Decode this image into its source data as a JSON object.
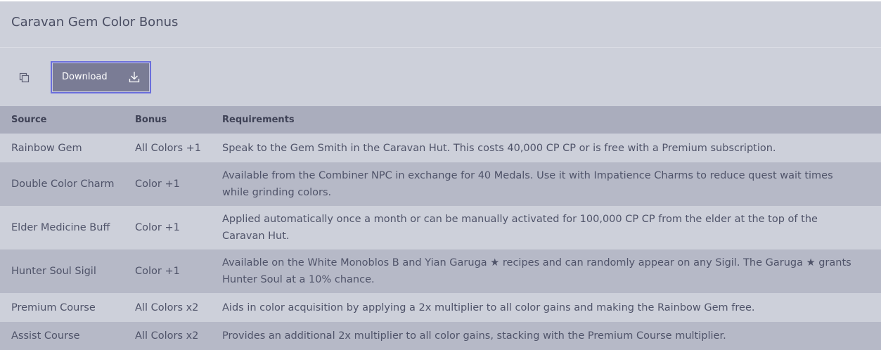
{
  "header": {
    "title": "Caravan Gem Color Bonus"
  },
  "toolbar": {
    "copy_icon": "copy-icon",
    "download_label": "Download",
    "download_icon": "download-icon"
  },
  "table": {
    "columns": [
      "Source",
      "Bonus",
      "Requirements"
    ],
    "rows": [
      {
        "source": "Rainbow Gem",
        "bonus": "All Colors +1",
        "requirements": "Speak to the Gem Smith in the Caravan Hut. This costs 40,000 CP CP or is free with a Premium subscription."
      },
      {
        "source": "Double Color Charm",
        "bonus": "Color +1",
        "requirements": "Available from the Combiner NPC in exchange for 40 Medals. Use it with Impatience Charms to reduce quest wait times while grinding colors."
      },
      {
        "source": "Elder Medicine Buff",
        "bonus": "Color +1",
        "requirements": "Applied automatically once a month or can be manually activated for 100,000 CP CP from the elder at the top of the Caravan Hut."
      },
      {
        "source": "Hunter Soul Sigil",
        "bonus": "Color +1",
        "requirements": "Available on the White Monoblos B and Yian Garuga ★ recipes and can randomly appear on any Sigil. The Garuga ★ grants Hunter Soul at a 10% chance."
      },
      {
        "source": "Premium Course",
        "bonus": "All Colors x2",
        "requirements": "Aids in color acquisition by applying a 2x multiplier to all color gains and making the Rainbow Gem free."
      },
      {
        "source": "Assist Course",
        "bonus": "All Colors x2",
        "requirements": "Provides an additional 2x multiplier to all color gains, stacking with the Premium Course multiplier."
      }
    ]
  },
  "colors": {
    "panel_bg": "#cdd0da",
    "header_row_bg": "#aaadbd",
    "stripe_bg": "#b6b9c7",
    "button_bg": "#7a7c95",
    "button_focus_ring": "#6b6fdc"
  }
}
